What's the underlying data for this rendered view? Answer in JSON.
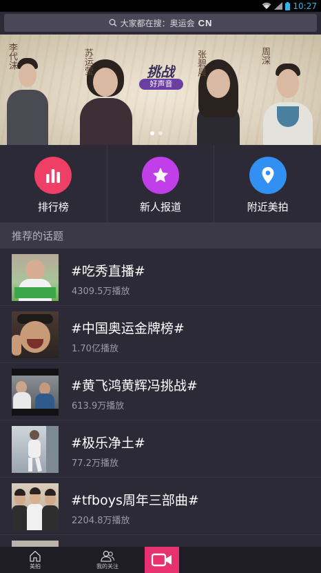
{
  "status_bar": {
    "time": "10:27"
  },
  "search": {
    "text": "大家都在搜：奥运会",
    "brand": "CN"
  },
  "banner": {
    "logo_title": "挑战",
    "logo_subtitle": "好声音",
    "slide_count": 2,
    "active_slide": 1
  },
  "quick_actions": [
    {
      "label": "排行榜",
      "icon": "bar-chart-icon",
      "color": "#ef3f67"
    },
    {
      "label": "新人报道",
      "icon": "star-icon",
      "color": "#c13fe8"
    },
    {
      "label": "附近美拍",
      "icon": "location-pin-icon",
      "color": "#3390f3"
    }
  ],
  "section": {
    "title": "推荐的话题"
  },
  "topics": [
    {
      "title": "#吃秀直播#",
      "plays": "4309.5万播放"
    },
    {
      "title": "#中国奥运金牌榜#",
      "plays": "1.70亿播放"
    },
    {
      "title": "#黄飞鸿黄辉冯挑战#",
      "plays": "613.9万播放"
    },
    {
      "title": "#极乐净土#",
      "plays": "77.2万播放"
    },
    {
      "title": "#tfboys周年三部曲#",
      "plays": "2204.8万播放"
    }
  ],
  "bottom_nav": {
    "home_label": "美拍",
    "following_label": "我的关注"
  },
  "colors": {
    "accent": "#e8316f",
    "background": "#2c2a37",
    "status_time": "#33b5e5"
  }
}
